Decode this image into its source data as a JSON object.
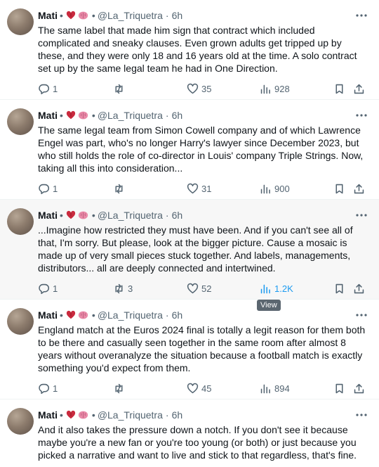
{
  "tweets": [
    {
      "name": "Mati",
      "handle": "@La_Triquetra",
      "time": "6h",
      "text": "The same label that made him sign that contract which included complicated and sneaky clauses. Even grown adults get tripped up by these, and they were only 18 and 16 years old at the time. A solo contract set up by the same legal team he had in One Direction.",
      "replies": "1",
      "retweets": "",
      "likes": "35",
      "views": "928"
    },
    {
      "name": "Mati",
      "handle": "@La_Triquetra",
      "time": "6h",
      "text": "The same legal team from Simon Cowell company and of which Lawrence Engel was part, who's no longer Harry's lawyer since December 2023, but who still holds the role of co-director in Louis' company Triple Strings. Now, taking all this into consideration...",
      "replies": "1",
      "retweets": "",
      "likes": "31",
      "views": "900"
    },
    {
      "name": "Mati",
      "handle": "@La_Triquetra",
      "time": "6h",
      "text": "...Imagine how restricted they must have been. And if you can't see all of that, I'm sorry. But please, look at the bigger picture. Cause a mosaic is made up of very small pieces stuck together. And labels, managements, distributors... all are deeply connected and intertwined.",
      "replies": "1",
      "retweets": "3",
      "likes": "52",
      "views": "1.2K"
    },
    {
      "name": "Mati",
      "handle": "@La_Triquetra",
      "time": "6h",
      "text": "England match at the Euros 2024 final is totally a legit reason for them both to be there and casually seen together in the same room after almost 8 years without overanalyze the situation because a football match is exactly something you'd expect from them.",
      "replies": "1",
      "retweets": "",
      "likes": "45",
      "views": "894"
    },
    {
      "name": "Mati",
      "handle": "@La_Triquetra",
      "time": "6h",
      "text": "And it also takes the pressure down a notch. If you don't see it because maybe you're a new fan or you're too young (or both) or just because you picked a narrative and want to live and stick to that regardless, that's fine.",
      "replies": "",
      "retweets": "",
      "likes": "",
      "views": ""
    }
  ],
  "tooltip": "View",
  "colors": {
    "accent": "#1d9bf0",
    "muted": "#536471",
    "hover_bg": "#f7f7f7",
    "heart": "#c92a3e",
    "brain": "#e98aa8"
  },
  "icons": [
    "heart-emoji-icon",
    "brain-emoji-icon",
    "more-icon",
    "reply-icon",
    "retweet-icon",
    "like-icon",
    "views-icon",
    "bookmark-icon",
    "share-icon"
  ]
}
